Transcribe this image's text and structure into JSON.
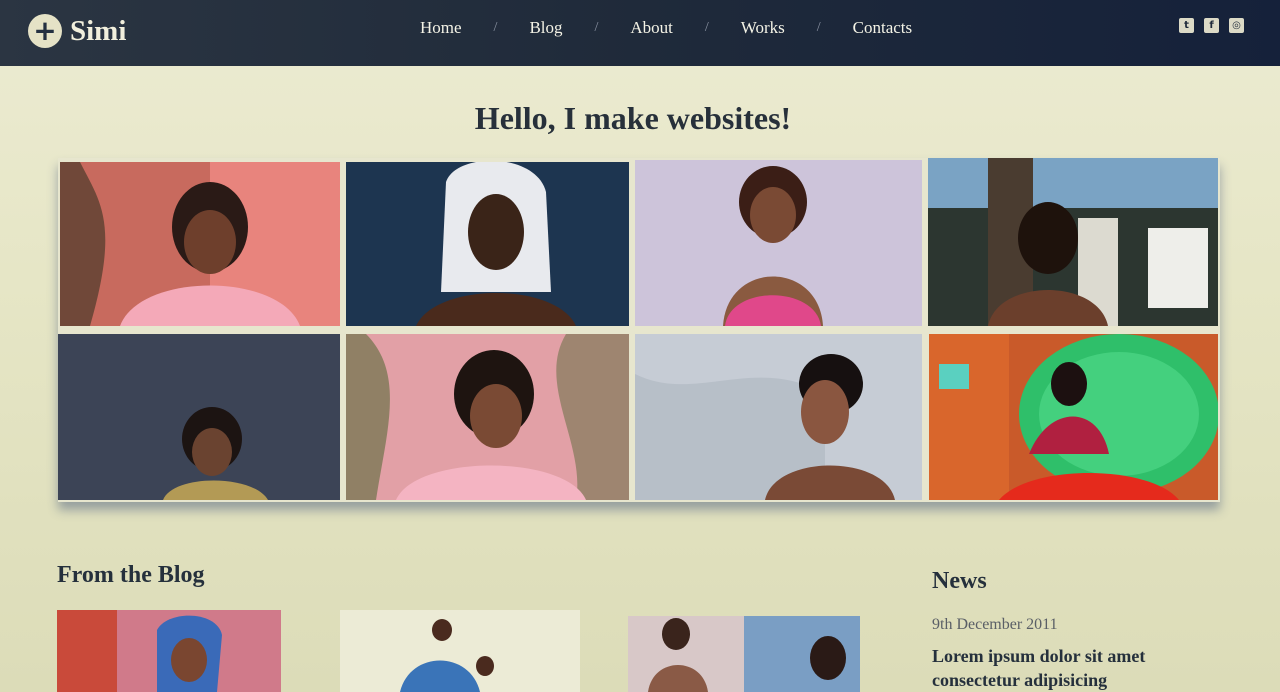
{
  "brand": {
    "icon": "plus-circle-icon",
    "name": "Simi"
  },
  "nav": {
    "items": [
      "Home",
      "Blog",
      "About",
      "Works",
      "Contacts"
    ],
    "separator": "/"
  },
  "social": [
    {
      "icon": "twitter-icon",
      "glyph": "t"
    },
    {
      "icon": "facebook-icon",
      "glyph": "f"
    },
    {
      "icon": "instagram-icon",
      "glyph": "◎"
    }
  ],
  "hero": {
    "title": "Hello, I make websites!"
  },
  "gallery": {
    "tiles": [
      {
        "name": "photo-pink-puff",
        "bg": "#d9716a",
        "accent": "#f3a7b4"
      },
      {
        "name": "photo-white-hair",
        "bg": "#1d3850",
        "accent": "#e8eaf0"
      },
      {
        "name": "photo-lavender",
        "bg": "#cfc6dc",
        "accent": "#e0488a"
      },
      {
        "name": "photo-garden",
        "bg": "#4c5c58",
        "accent": "#e6e2d4"
      },
      {
        "name": "photo-dark-studio",
        "bg": "#3e4658",
        "accent": "#b39a55"
      },
      {
        "name": "photo-pink-vines",
        "bg": "#e6a2aa",
        "accent": "#f6b8c4"
      },
      {
        "name": "photo-marble",
        "bg": "#c9d0d8",
        "accent": "#2a2a2a"
      },
      {
        "name": "photo-green-chair",
        "bg": "#d4602c",
        "accent": "#3fd07a"
      }
    ]
  },
  "blog": {
    "heading": "From the Blog"
  },
  "news": {
    "heading": "News",
    "date": "9th December 2011",
    "title": "Lorem ipsum dolor sit amet consectetur adipisicing"
  }
}
